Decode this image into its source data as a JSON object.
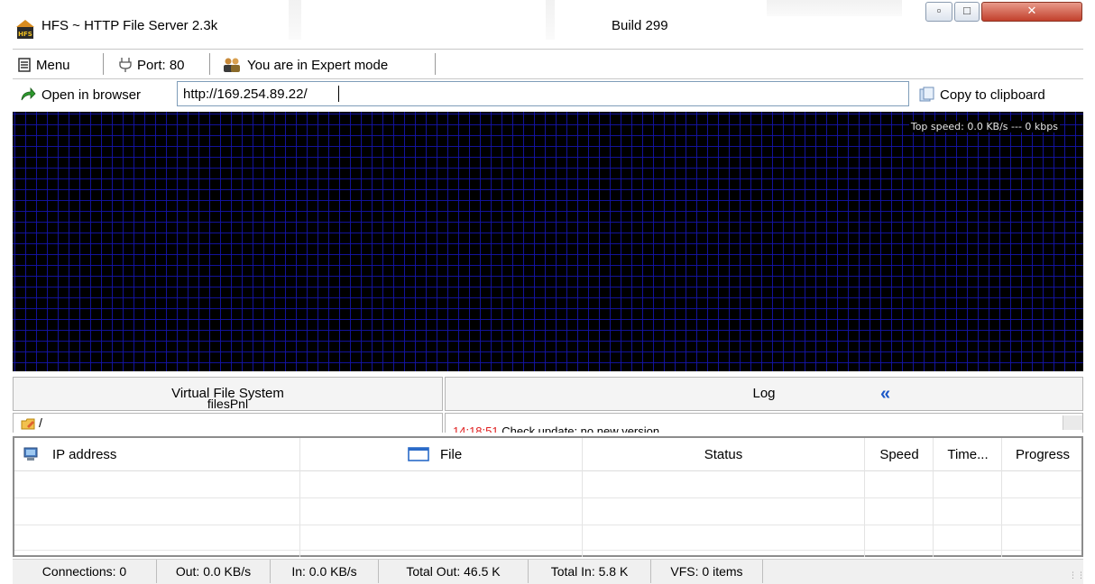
{
  "window": {
    "title": "HFS ~ HTTP File Server 2.3k",
    "build": "Build 299",
    "controls": {
      "minimize_icon": "minimize-icon",
      "maximize_icon": "maximize-icon",
      "close_icon": "close-icon"
    }
  },
  "toolbar": {
    "menu_label": "Menu",
    "port_label": "Port: 80",
    "mode_label": "You are in Expert mode"
  },
  "address_bar": {
    "open_label": "Open in browser",
    "url": "http://169.254.89.22/",
    "copy_label": "Copy to clipboard"
  },
  "graph": {
    "top_speed": "Top speed: 0.0 KB/s  ---  0 kbps",
    "background": "#000000",
    "grid_color": "#1414aa"
  },
  "vfs": {
    "title": "Virtual File System",
    "subtitle": "filesPnl",
    "root": "/"
  },
  "log": {
    "title": "Log",
    "time": "14:18:51",
    "message": " Check update: no new version"
  },
  "connections": {
    "columns": [
      "IP address",
      "File",
      "Status",
      "Speed",
      "Time...",
      "Progress"
    ],
    "rows": []
  },
  "statusbar": {
    "connections": "Connections: 0",
    "out": "Out: 0.0 KB/s",
    "in": "In: 0.0 KB/s",
    "total_out": "Total Out: 46.5 K",
    "total_in": "Total In: 5.8 K",
    "vfs": "VFS: 0 items"
  }
}
